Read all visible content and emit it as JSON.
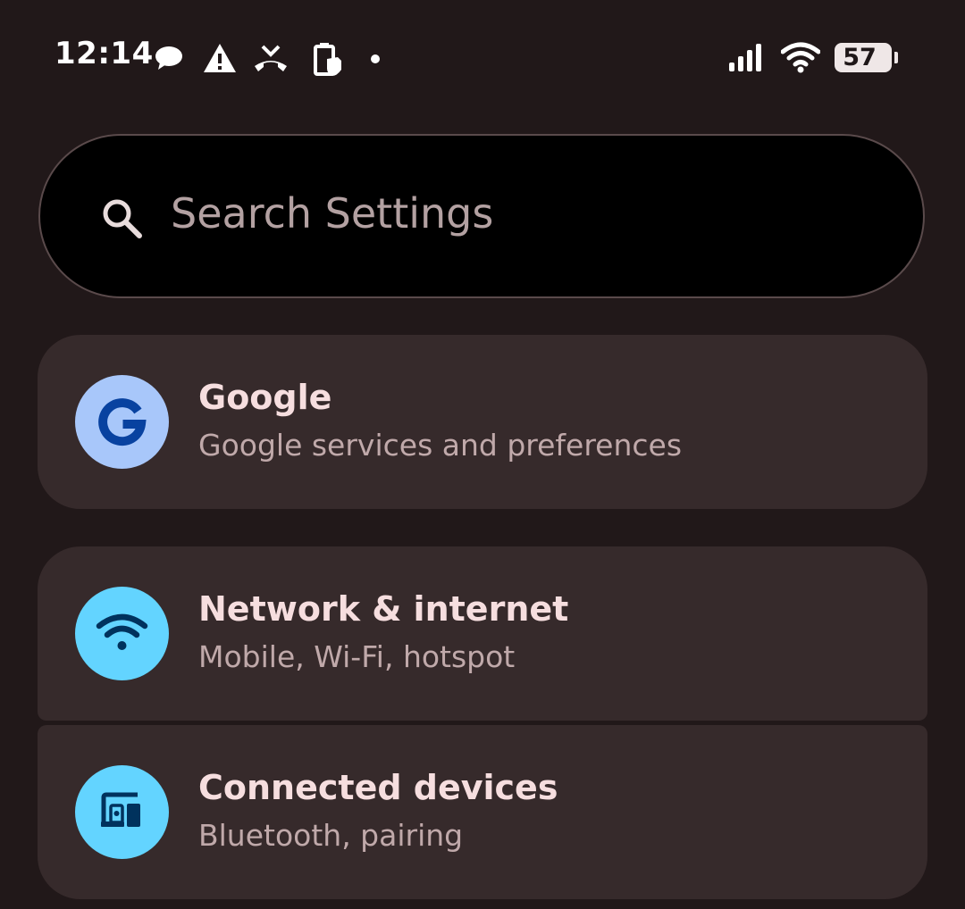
{
  "status_bar": {
    "time": "12:14",
    "battery_level": "57",
    "icons": [
      "chat-bubble-icon",
      "warning-icon",
      "missed-call-icon",
      "battery-saver-icon",
      "notification-dot-icon",
      "cellular-signal-icon",
      "wifi-icon",
      "battery-icon"
    ]
  },
  "search": {
    "placeholder": "Search Settings"
  },
  "settings": [
    {
      "title": "Google",
      "subtitle": "Google services and preferences",
      "icon": "google-icon",
      "icon_color": "#a8c7fa"
    },
    {
      "title": "Network & internet",
      "subtitle": "Mobile, Wi-Fi, hotspot",
      "icon": "wifi-icon",
      "icon_color": "#63d4ff"
    },
    {
      "title": "Connected devices",
      "subtitle": "Bluetooth, pairing",
      "icon": "connected-devices-icon",
      "icon_color": "#63d4ff"
    }
  ],
  "colors": {
    "background": "#211819",
    "card": "#362a2b",
    "title_text": "#f6dedf",
    "subtitle_text": "#c0a9aa",
    "icon_glyph": "#00325d"
  }
}
